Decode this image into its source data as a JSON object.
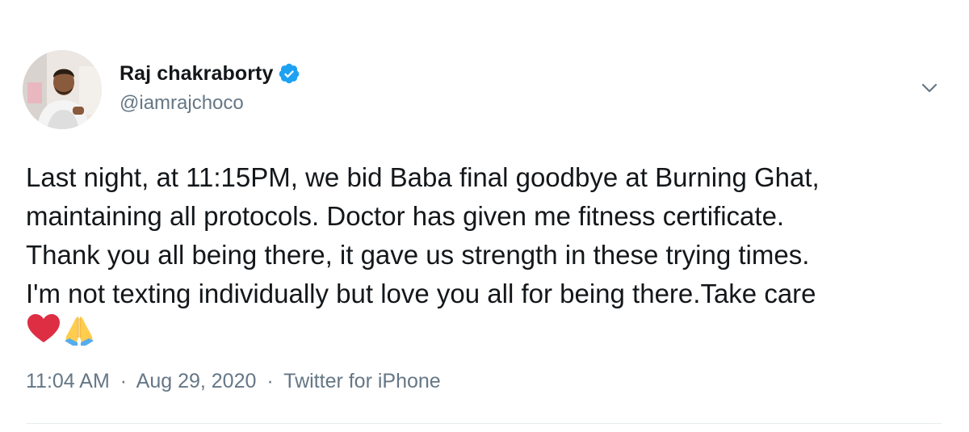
{
  "user": {
    "display_name": "Raj chakraborty",
    "handle": "@iamrajchoco",
    "verified": true,
    "avatar_icon": "profile-photo"
  },
  "tweet": {
    "lines": [
      "Last night, at 11:15PM, we bid Baba final goodbye at Burning Ghat,",
      "maintaining all protocols. Doctor has given me fitness certificate.",
      "Thank you all being there, it gave us strength in these trying times.",
      "I'm not texting individually but love you all for being there.Take care"
    ],
    "emojis": [
      "red-heart-icon",
      "folded-hands-icon"
    ]
  },
  "meta": {
    "time": "11:04 AM",
    "date": "Aug 29, 2020",
    "source": "Twitter for iPhone",
    "separator": "·"
  },
  "colors": {
    "text": "#14171a",
    "secondary": "#657786",
    "verified_blue": "#1da1f2",
    "divider": "#e6ecf0"
  }
}
